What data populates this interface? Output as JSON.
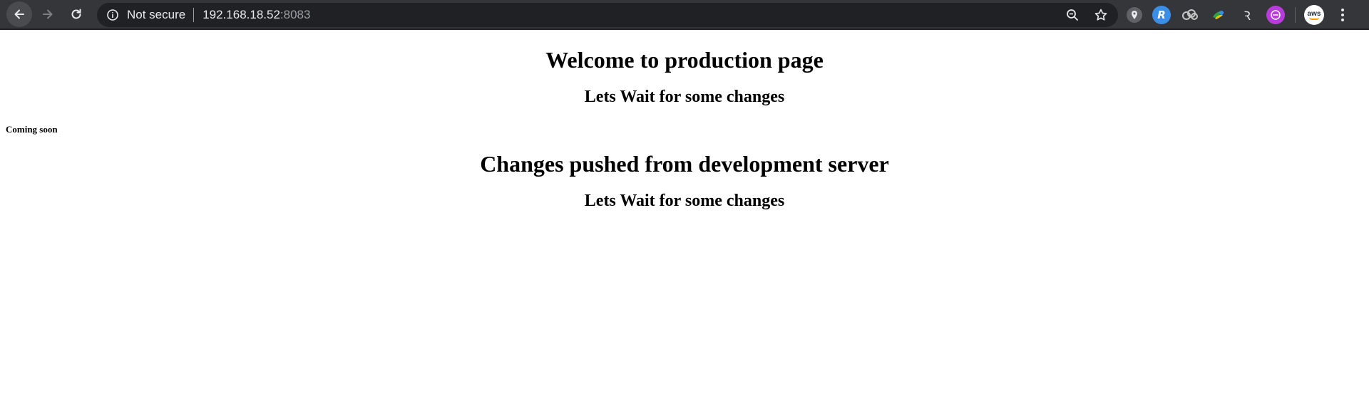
{
  "browser": {
    "security_label": "Not secure",
    "url_host": "192.168.18.52",
    "url_port": ":8083",
    "icons": {
      "back": "back-arrow-icon",
      "forward": "forward-arrow-icon",
      "reload": "reload-icon",
      "info": "info-icon",
      "zoom": "zoom-out-icon",
      "bookmark": "star-icon",
      "menu": "more-vert-icon"
    },
    "extensions": [
      "location-pin-extension",
      "r-blue-extension",
      "cloud-extension",
      "colorful-extension",
      "r-mono-extension",
      "purple-circle-extension"
    ],
    "avatar_text": "aws"
  },
  "page": {
    "heading1": "Welcome to production page",
    "subheading1": "Lets Wait for some changes",
    "small_note": "Coming soon",
    "heading2": "Changes pushed from development server",
    "subheading2": "Lets Wait for some changes"
  },
  "colors": {
    "toolbar_bg": "#35363a",
    "omnibox_bg": "#202124",
    "text_light": "#e8eaed",
    "text_muted": "#9aa0a6"
  }
}
